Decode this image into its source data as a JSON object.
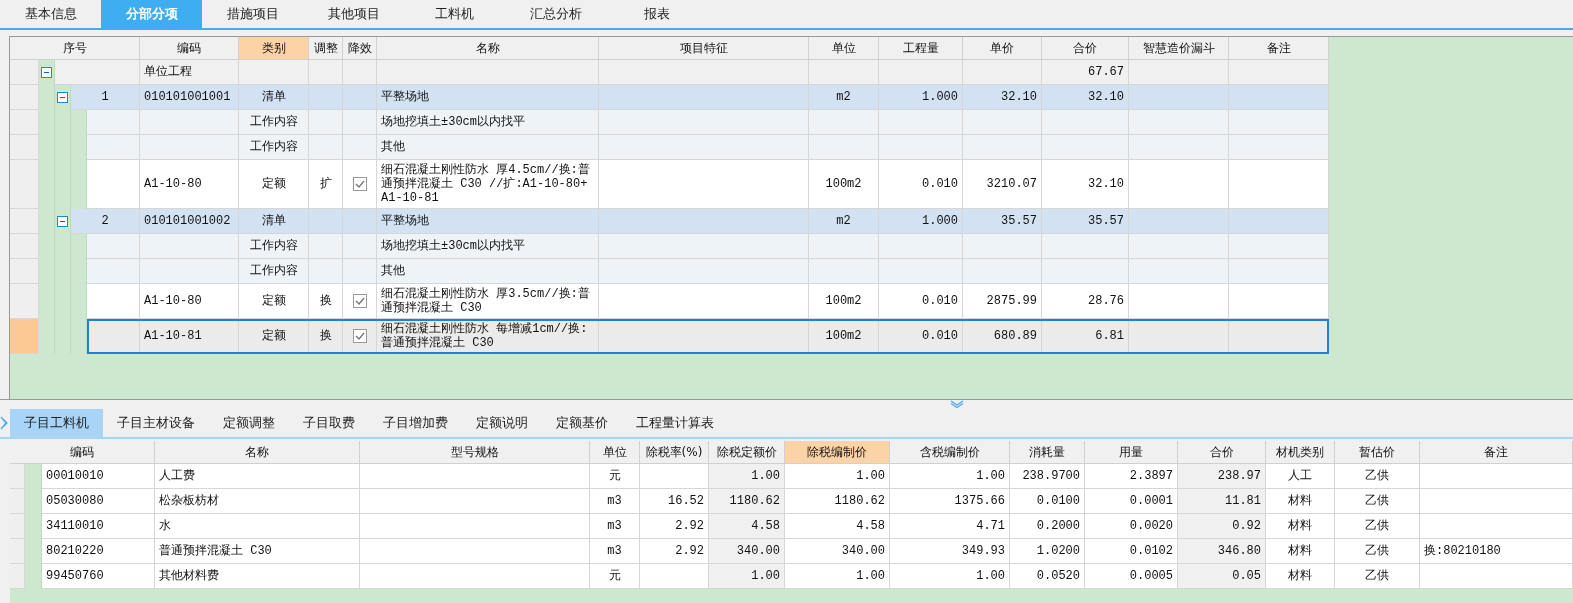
{
  "tabs": [
    {
      "label": "基本信息",
      "selected": false
    },
    {
      "label": "分部分项",
      "selected": true
    },
    {
      "label": "措施项目",
      "selected": false
    },
    {
      "label": "其他项目",
      "selected": false
    },
    {
      "label": "工料机",
      "selected": false
    },
    {
      "label": "汇总分析",
      "selected": false
    },
    {
      "label": "报表",
      "selected": false
    }
  ],
  "grid": {
    "columns": [
      {
        "label": "序号",
        "highlighted": false
      },
      {
        "label": "编码",
        "highlighted": false
      },
      {
        "label": "类别",
        "highlighted": true
      },
      {
        "label": "调整",
        "highlighted": false
      },
      {
        "label": "降效",
        "highlighted": false
      },
      {
        "label": "名称",
        "highlighted": false
      },
      {
        "label": "项目特征",
        "highlighted": false
      },
      {
        "label": "单位",
        "highlighted": false
      },
      {
        "label": "工程量",
        "highlighted": false
      },
      {
        "label": "单价",
        "highlighted": false
      },
      {
        "label": "合价",
        "highlighted": false
      },
      {
        "label": "智慧造价漏斗",
        "highlighted": false
      },
      {
        "label": "备注",
        "highlighted": false
      }
    ],
    "rows": [
      {
        "kind": "unit",
        "code": "单位工程",
        "total": "67.67",
        "selected": false,
        "expanded": true,
        "children": [
          {
            "kind": "item",
            "no": "1",
            "code": "010101001001",
            "type": "清单",
            "name": "平整场地",
            "unit": "m2",
            "qty": "1.000",
            "price": "32.10",
            "total": "32.10",
            "selected": false,
            "expanded": true,
            "children": [
              {
                "kind": "work",
                "type": "工作内容",
                "name": "场地挖填土±30cm以内找平",
                "selected": false
              },
              {
                "kind": "work",
                "type": "工作内容",
                "name": "其他",
                "selected": false
              },
              {
                "kind": "quota",
                "code": "A1-10-80",
                "type": "定额",
                "adjust": "扩",
                "checked": true,
                "name": "细石混凝土刚性防水 厚4.5cm//换:普通预拌混凝土 C30 //扩:A1-10-80+A1-10-81",
                "unit": "100m2",
                "qty": "0.010",
                "price": "3210.07",
                "total": "32.10",
                "selected": false
              }
            ]
          },
          {
            "kind": "item",
            "no": "2",
            "code": "010101001002",
            "type": "清单",
            "name": "平整场地",
            "unit": "m2",
            "qty": "1.000",
            "price": "35.57",
            "total": "35.57",
            "selected": false,
            "expanded": true,
            "children": [
              {
                "kind": "work",
                "type": "工作内容",
                "name": "场地挖填土±30cm以内找平",
                "selected": false
              },
              {
                "kind": "work",
                "type": "工作内容",
                "name": "其他",
                "selected": false
              },
              {
                "kind": "quota",
                "code": "A1-10-80",
                "type": "定额",
                "adjust": "换",
                "checked": true,
                "name": "细石混凝土刚性防水 厚3.5cm//换:普通预拌混凝土 C30",
                "unit": "100m2",
                "qty": "0.010",
                "price": "2875.99",
                "total": "28.76",
                "selected": false
              },
              {
                "kind": "quota",
                "code": "A1-10-81",
                "type": "定额",
                "adjust": "换",
                "checked": true,
                "name": "细石混凝土刚性防水 每增减1cm//换:普通预拌混凝土 C30",
                "unit": "100m2",
                "qty": "0.010",
                "price": "680.89",
                "total": "6.81",
                "selected": true
              }
            ]
          }
        ]
      }
    ]
  },
  "detail_tabs": [
    {
      "label": "子目工料机",
      "selected": true
    },
    {
      "label": "子目主材设备",
      "selected": false
    },
    {
      "label": "定额调整",
      "selected": false
    },
    {
      "label": "子目取费",
      "selected": false
    },
    {
      "label": "子目增加费",
      "selected": false
    },
    {
      "label": "定额说明",
      "selected": false
    },
    {
      "label": "定额基价",
      "selected": false
    },
    {
      "label": "工程量计算表",
      "selected": false
    }
  ],
  "materials": {
    "columns": [
      {
        "label": "编码",
        "highlighted": false,
        "readonly": false
      },
      {
        "label": "名称",
        "highlighted": false,
        "readonly": false
      },
      {
        "label": "型号规格",
        "highlighted": false,
        "readonly": false
      },
      {
        "label": "单位",
        "highlighted": false,
        "readonly": false
      },
      {
        "label": "除税率(%)",
        "highlighted": false,
        "readonly": false
      },
      {
        "label": "除税定额价",
        "highlighted": false,
        "readonly": true
      },
      {
        "label": "除税编制价",
        "highlighted": true,
        "readonly": false
      },
      {
        "label": "含税编制价",
        "highlighted": false,
        "readonly": false
      },
      {
        "label": "消耗量",
        "highlighted": false,
        "readonly": false
      },
      {
        "label": "用量",
        "highlighted": false,
        "readonly": false
      },
      {
        "label": "合价",
        "highlighted": false,
        "readonly": true
      },
      {
        "label": "材机类别",
        "highlighted": false,
        "readonly": false
      },
      {
        "label": "暂估价",
        "highlighted": false,
        "readonly": false
      },
      {
        "label": "备注",
        "highlighted": false,
        "readonly": false
      }
    ],
    "rows": [
      [
        "00010010",
        "人工费",
        "",
        "元",
        "",
        "1.00",
        "1.00",
        "1.00",
        "238.9700",
        "2.3897",
        "238.97",
        "人工",
        "乙供",
        ""
      ],
      [
        "05030080",
        "松杂板枋材",
        "",
        "m3",
        "16.52",
        "1180.62",
        "1180.62",
        "1375.66",
        "0.0100",
        "0.0001",
        "11.81",
        "材料",
        "乙供",
        ""
      ],
      [
        "34110010",
        "水",
        "",
        "m3",
        "2.92",
        "4.58",
        "4.58",
        "4.71",
        "0.2000",
        "0.0020",
        "0.92",
        "材料",
        "乙供",
        ""
      ],
      [
        "80210220",
        "普通预拌混凝土 C30",
        "",
        "m3",
        "2.92",
        "340.00",
        "340.00",
        "349.93",
        "1.0200",
        "0.0102",
        "346.80",
        "材料",
        "乙供",
        "换:80210180"
      ],
      [
        "99450760",
        "其他材料费",
        "",
        "元",
        "",
        "1.00",
        "1.00",
        "1.00",
        "0.0520",
        "0.0005",
        "0.05",
        "材料",
        "乙供",
        ""
      ]
    ]
  }
}
